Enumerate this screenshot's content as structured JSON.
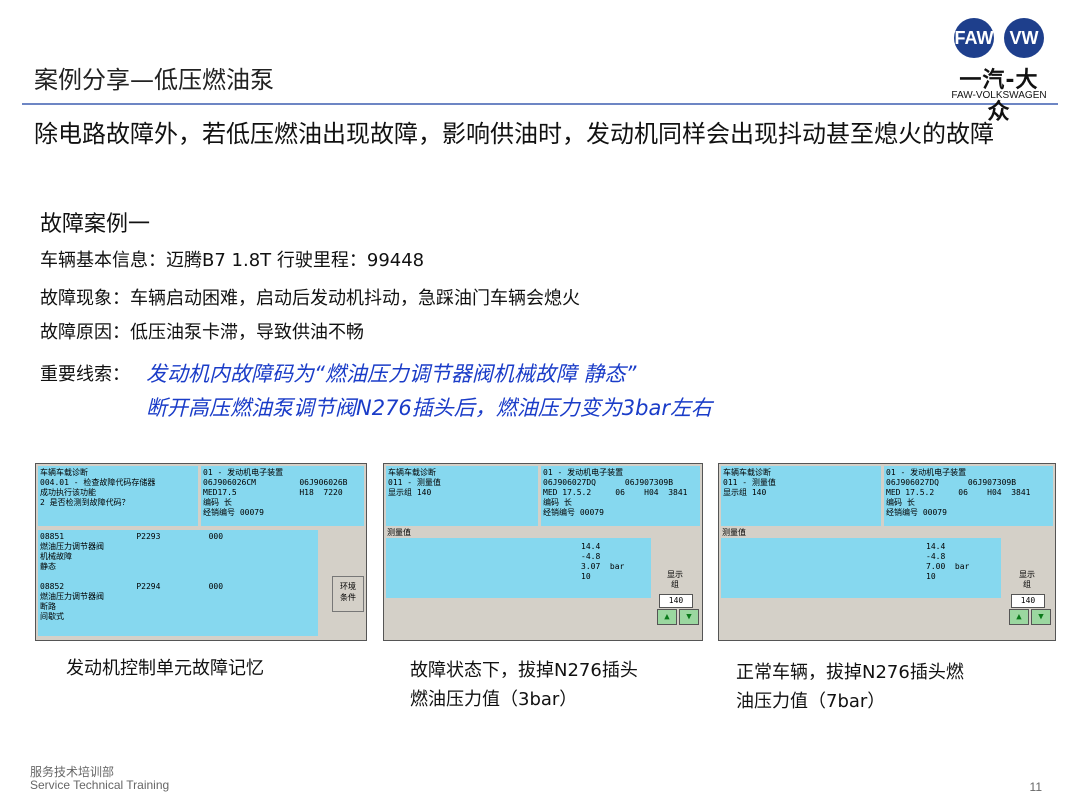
{
  "slide": {
    "title": "案例分享—低压燃油泵",
    "intro": "除电路故障外，若低压燃油出现故障，影响供油时，发动机同样会出现抖动甚至熄火的故障",
    "case_title": "故障案例一",
    "vehicle_info": "车辆基本信息：迈腾B7  1.8T   行驶里程：99448",
    "symptom": "故障现象：车辆启动困难，启动后发动机抖动，急踩油门车辆会熄火",
    "cause": "故障原因：低压油泵卡滞，导致供油不畅",
    "clue_label": "重要线索：",
    "clue_line1": "发动机内故障码为“燃油压力调节器阀机械故障 静态”",
    "clue_line2": "断开高压燃油泵调节阀N276插头后，燃油压力变为3bar左右"
  },
  "logo": {
    "faw_symbol": "FAW",
    "vw_symbol": "VW",
    "cn": "一汽-大众",
    "en": "FAW-VOLKSWAGEN"
  },
  "panels": [
    {
      "hdr_left": "车辆车载诊断\n004.01 - 检查故障代码存储器\n成功执行该功能\n2 是否检测到故障代码？",
      "hdr_right": "01 - 发动机电子装置\n06J906026CM         06J906026B\nMED17.5             H18  7220\n编码 长\n经销编号 00079",
      "body_left": "08851               P2293          000\n燃油压力调节器阀\n机械故障\n静态\n\n08852               P2294          000\n燃油压力调节器阀\n断路\n间歇式",
      "button": "环境\n条件"
    },
    {
      "hdr_left": "车辆车载诊断\n011 - 测量值\n显示组 140",
      "hdr_right": "01 - 发动机电子装置\n06J906027DQ      06J907309B\nMED 17.5.2     06    H04  3841\n编码 长\n经销编号 00079",
      "label": "测量值",
      "values": "14.4\n-4.8\n3.07  bar\n10",
      "group_label": "显示\n组",
      "group_num": "140",
      "up": "▲",
      "down": "▼"
    },
    {
      "hdr_left": "车辆车载诊断\n011 - 测量值\n显示组 140",
      "hdr_right": "01 - 发动机电子装置\n06J906027DQ      06J907309B\nMED 17.5.2     06    H04  3841\n编码 长\n经销编号 00079",
      "label": "测量值",
      "values": "14.4\n-4.8\n7.00  bar\n10",
      "group_label": "显示\n组",
      "group_num": "140",
      "up": "▲",
      "down": "▼"
    }
  ],
  "captions": [
    "发动机控制单元故障记忆",
    "故障状态下，拔掉N276插头\n燃油压力值（3bar）",
    "正常车辆，拔掉N276插头燃\n油压力值（7bar）"
  ],
  "footer": {
    "cn": "服务技术培训部",
    "en": "Service Technical Training",
    "page": "11"
  }
}
